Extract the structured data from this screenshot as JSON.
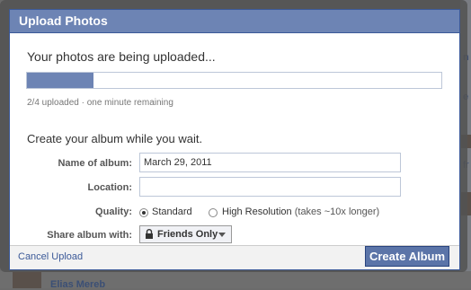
{
  "dialog": {
    "title": "Upload Photos",
    "status_text": "Your photos are being uploaded...",
    "progress": {
      "fraction": 0.16
    },
    "progress_text": "2/4 uploaded · one minute remaining",
    "prompt": "Create your album while you wait.",
    "fields": {
      "name_label": "Name of album:",
      "name_value": "March 29, 2011",
      "location_label": "Location:",
      "location_value": "",
      "quality_label": "Quality:",
      "quality_options": [
        {
          "label": "Standard",
          "selected": true
        },
        {
          "label": "High Resolution",
          "note": "(takes ~10x longer)",
          "selected": false
        }
      ],
      "share_label": "Share album with:",
      "share_value": "Friends Only"
    },
    "footer": {
      "cancel_label": "Cancel Upload",
      "create_label": "Create Album"
    }
  },
  "background": {
    "visible_name": "Elias Mereb"
  },
  "colors": {
    "titlebar": "#6d84b4",
    "border": "#3b5998",
    "progress_fill": "#6d84b4",
    "button": "#5b74a8",
    "link": "#3b5998"
  }
}
